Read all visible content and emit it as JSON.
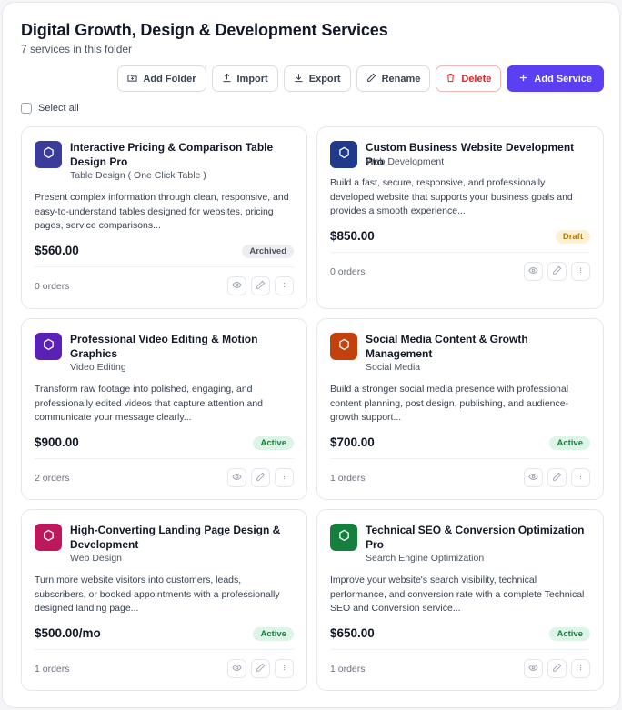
{
  "folder": {
    "title": "Digital Growth, Design & Development Services",
    "subtitle": "7 services in this folder"
  },
  "toolbar": {
    "add_folder": "Add Folder",
    "import": "Import",
    "export": "Export",
    "rename": "Rename",
    "delete": "Delete",
    "add_service": "Add Service"
  },
  "select_all": "Select all",
  "colors": {
    "primary": "#5b3ff2",
    "danger": "#dc2626",
    "status_active": "#15803d",
    "status_draft": "#b4790d",
    "status_archived": "#4b5563"
  },
  "services": [
    {
      "title": "Interactive Pricing & Comparison Table Design Pro",
      "category": "Table Design ( One Click Table )",
      "description": "Present complex information through clean, responsive, and easy-to-understand tables designed for websites, pricing pages, service comparisons...",
      "price": "$560.00",
      "status": "Archived",
      "orders": "0 orders",
      "icon_color": "#3b3b9a",
      "icon": "hexagon-icon"
    },
    {
      "title": "Custom Business Website Development Pro",
      "category": "Web Development",
      "description": "Build a fast, secure, responsive, and professionally developed website that supports your business goals and provides a smooth experience...",
      "price": "$850.00",
      "status": "Draft",
      "orders": "0 orders",
      "icon_color": "#1f3a8a",
      "icon": "hexagon-icon"
    },
    {
      "title": "Professional Video Editing & Motion Graphics",
      "category": "Video Editing",
      "description": "Transform raw footage into polished, engaging, and professionally edited videos that capture attention and communicate your message clearly...",
      "price": "$900.00",
      "status": "Active",
      "orders": "2 orders",
      "icon_color": "#5b21b6",
      "icon": "hexagon-icon"
    },
    {
      "title": "Social Media Content & Growth Management",
      "category": "Social Media",
      "description": "Build a stronger social media presence with professional content planning, post design, publishing, and audience-growth support...",
      "price": "$700.00",
      "status": "Active",
      "orders": "1 orders",
      "icon_color": "#c2410c",
      "icon": "hexagon-icon"
    },
    {
      "title": "High-Converting Landing Page Design & Development",
      "category": "Web Design",
      "description": "Turn more website visitors into customers, leads, subscribers, or booked appointments with a professionally designed landing page...",
      "price": "$500.00/mo",
      "status": "Active",
      "orders": "1 orders",
      "icon_color": "#be185d",
      "icon": "hexagon-icon"
    },
    {
      "title": "Technical SEO & Conversion Optimization Pro",
      "category": "Search Engine Optimization",
      "description": "Improve your website's search visibility, technical performance, and conversion rate with a complete Technical SEO and Conversion service...",
      "price": "$650.00",
      "status": "Active",
      "orders": "1 orders",
      "icon_color": "#15803d",
      "icon": "hexagon-icon"
    }
  ]
}
